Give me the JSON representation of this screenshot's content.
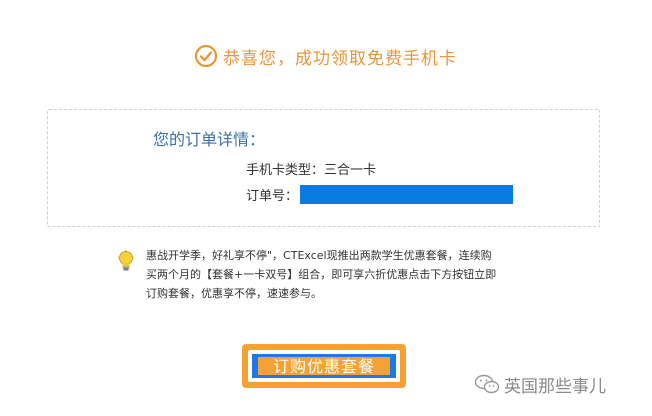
{
  "success": {
    "icon": "check-circle-icon",
    "message": "恭喜您，成功领取免费手机卡",
    "color": "#e9963a"
  },
  "order": {
    "title": "您的订单详情：",
    "card_type_label": "手机卡类型：",
    "card_type_value": "三合一卡",
    "order_no_label": "订单号：",
    "order_no_redaction_color": "#0a7be0"
  },
  "tip": {
    "icon": "lightbulb-icon",
    "lines": [
      "惠战开学季，好礼享不停\"，CTExcel现推出两款学生优惠套餐，连续购",
      "买两个月的【套餐+一卡双号】组合，即可享六折优惠点击下方按钮立即",
      "订购套餐，优惠享不停，速速参与。"
    ]
  },
  "button": {
    "label": "订购优惠套餐",
    "color": "#f4a236",
    "inner_color": "#1e78e6"
  },
  "watermark": {
    "icon": "wechat-icon",
    "text": "英国那些事儿"
  }
}
